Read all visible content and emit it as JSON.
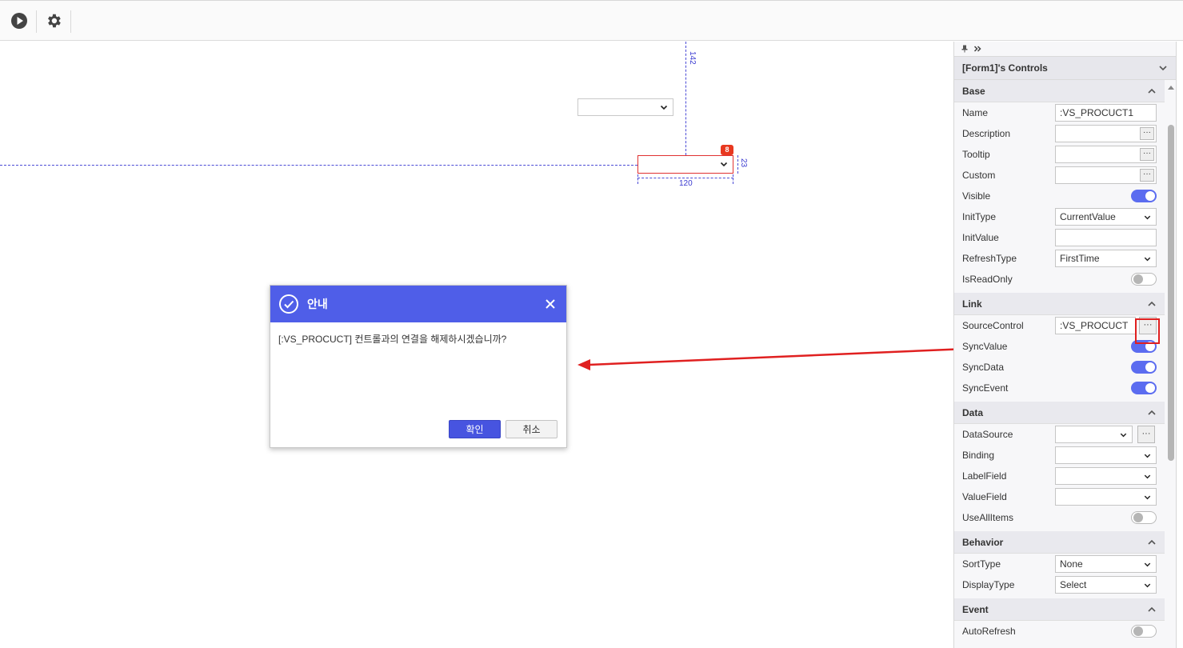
{
  "toolbar": {
    "run_icon": "play-circle-icon",
    "settings_icon": "gear-icon"
  },
  "canvas": {
    "dim_vertical": "142",
    "dim_height": "23",
    "dim_width": "120",
    "badge": "8"
  },
  "dialog": {
    "title": "안내",
    "message": "[:VS_PROCUCT] 컨트롤과의 연결을 해제하시겠습니까?",
    "ok_label": "확인",
    "cancel_label": "취소"
  },
  "panel": {
    "title": "[Form1]'s Controls",
    "sections": {
      "base": "Base",
      "link": "Link",
      "data": "Data",
      "behavior": "Behavior",
      "event": "Event"
    },
    "props": {
      "name_label": "Name",
      "name_value": ":VS_PROCUCT1",
      "description_label": "Description",
      "tooltip_label": "Tooltip",
      "custom_label": "Custom",
      "visible_label": "Visible",
      "inittype_label": "InitType",
      "inittype_value": "CurrentValue",
      "initvalue_label": "InitValue",
      "refreshtype_label": "RefreshType",
      "refreshtype_value": "FirstTime",
      "isreadonly_label": "IsReadOnly",
      "sourcecontrol_label": "SourceControl",
      "sourcecontrol_value": ":VS_PROCUCT",
      "syncvalue_label": "SyncValue",
      "syncdata_label": "SyncData",
      "syncevent_label": "SyncEvent",
      "datasource_label": "DataSource",
      "binding_label": "Binding",
      "labelfield_label": "LabelField",
      "valuefield_label": "ValueField",
      "useallitems_label": "UseAllItems",
      "sorttype_label": "SortType",
      "sorttype_value": "None",
      "displaytype_label": "DisplayType",
      "displaytype_value": "Select",
      "autorefresh_label": "AutoRefresh"
    },
    "toggles": {
      "visible": true,
      "isreadonly": false,
      "syncvalue": true,
      "syncdata": true,
      "syncevent": true,
      "useallitems": false,
      "autorefresh": false
    }
  },
  "colors": {
    "accent": "#4f5ee8",
    "toggle_on": "#5b6cf0",
    "highlight": "#e02020"
  }
}
